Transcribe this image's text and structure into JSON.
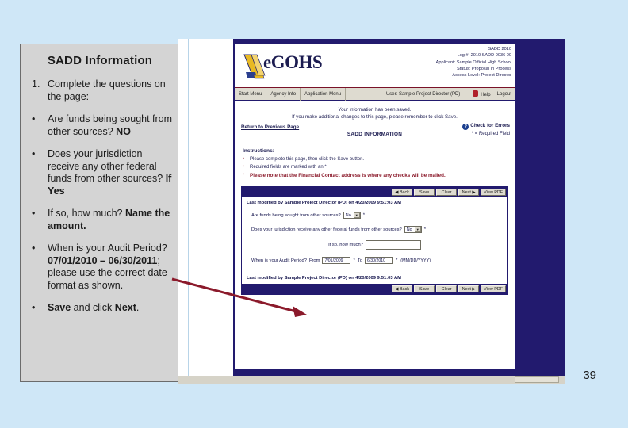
{
  "slide": {
    "page_number": "39",
    "accent_arrow_color": "#8b1a2b",
    "background_color": "#cfe7f7"
  },
  "left_panel": {
    "title": "SADD Information",
    "items": [
      {
        "marker": "1.",
        "parts": [
          {
            "text": "Complete the questions on the page:",
            "bold": false
          }
        ]
      },
      {
        "marker": "•",
        "parts": [
          {
            "text": "Are funds being sought from other sources? ",
            "bold": false
          },
          {
            "text": "NO",
            "bold": true
          }
        ]
      },
      {
        "marker": "•",
        "parts": [
          {
            "text": "Does your jurisdiction receive any other federal funds from other sources? ",
            "bold": false
          },
          {
            "text": "If Yes",
            "bold": true
          }
        ]
      },
      {
        "marker": "•",
        "parts": [
          {
            "text": "If so, how much? ",
            "bold": false
          },
          {
            "text": "Name the amount.",
            "bold": true
          }
        ]
      },
      {
        "marker": "•",
        "parts": [
          {
            "text": "When is your Audit Period? ",
            "bold": false
          },
          {
            "text": "07/01/2010 – 06/30/2011",
            "bold": true
          },
          {
            "text": "; please use the correct date format as shown.",
            "bold": false
          }
        ]
      },
      {
        "marker": "•",
        "parts": [
          {
            "text": "Save",
            "bold": true
          },
          {
            "text": " and click ",
            "bold": false
          },
          {
            "text": "Next",
            "bold": true
          },
          {
            "text": ".",
            "bold": false
          }
        ]
      }
    ]
  },
  "app": {
    "logo_text": "eGOHS",
    "meta": [
      "SADD 2010",
      "Log #: 2010 SADD 0036 00",
      "Applicant: Sample Official High School",
      "Status: Proposal In Process",
      "Access Level: Project Director"
    ],
    "nav": {
      "items": [
        "Start Menu",
        "Agency Info",
        "Application Menu"
      ],
      "user": "User: Sample Project Director (PD)",
      "help": "Help",
      "logout": "Logout"
    },
    "saved_message_line1": "Your information has been saved.",
    "saved_message_line2": "If you make additional changes to this page, please remember to click Save.",
    "return_link": "Return to Previous Page",
    "page_heading": "SADD INFORMATION",
    "check_errors": "Check for Errors",
    "required_field_note": "* = Required Field",
    "instructions_title": "Instructions:",
    "instructions": [
      {
        "text": "Please complete this page, then click the Save button.",
        "emphasis": false
      },
      {
        "text": "Required fields are marked with an *.",
        "emphasis": false
      },
      {
        "text": "Please note that the Financial Contact address is where any checks will be mailed.",
        "emphasis": true
      }
    ],
    "buttons": [
      "◀ Back",
      "Save",
      "Clear",
      "Next ▶",
      "View PDF"
    ],
    "last_modified": "Last modified by Sample Project Director (PD) on 4/20/2009 9:51:03 AM",
    "form": {
      "q1_label": "Are funds being sought from other sources?",
      "q1_value": "No",
      "q2_label": "Does your jurisdiction receive any other federal funds from other sources?",
      "q2_value": "No",
      "q3_label": "If so, how much?",
      "q3_value": "",
      "q4_label": "When is your Audit Period?",
      "q4_from_label": "From",
      "q4_from_value": "7/01/2009",
      "q4_to_label": "To",
      "q4_to_value": "6/30/2010",
      "q4_format": "(MM/DD/YYYY)",
      "required_marker": "*"
    }
  }
}
